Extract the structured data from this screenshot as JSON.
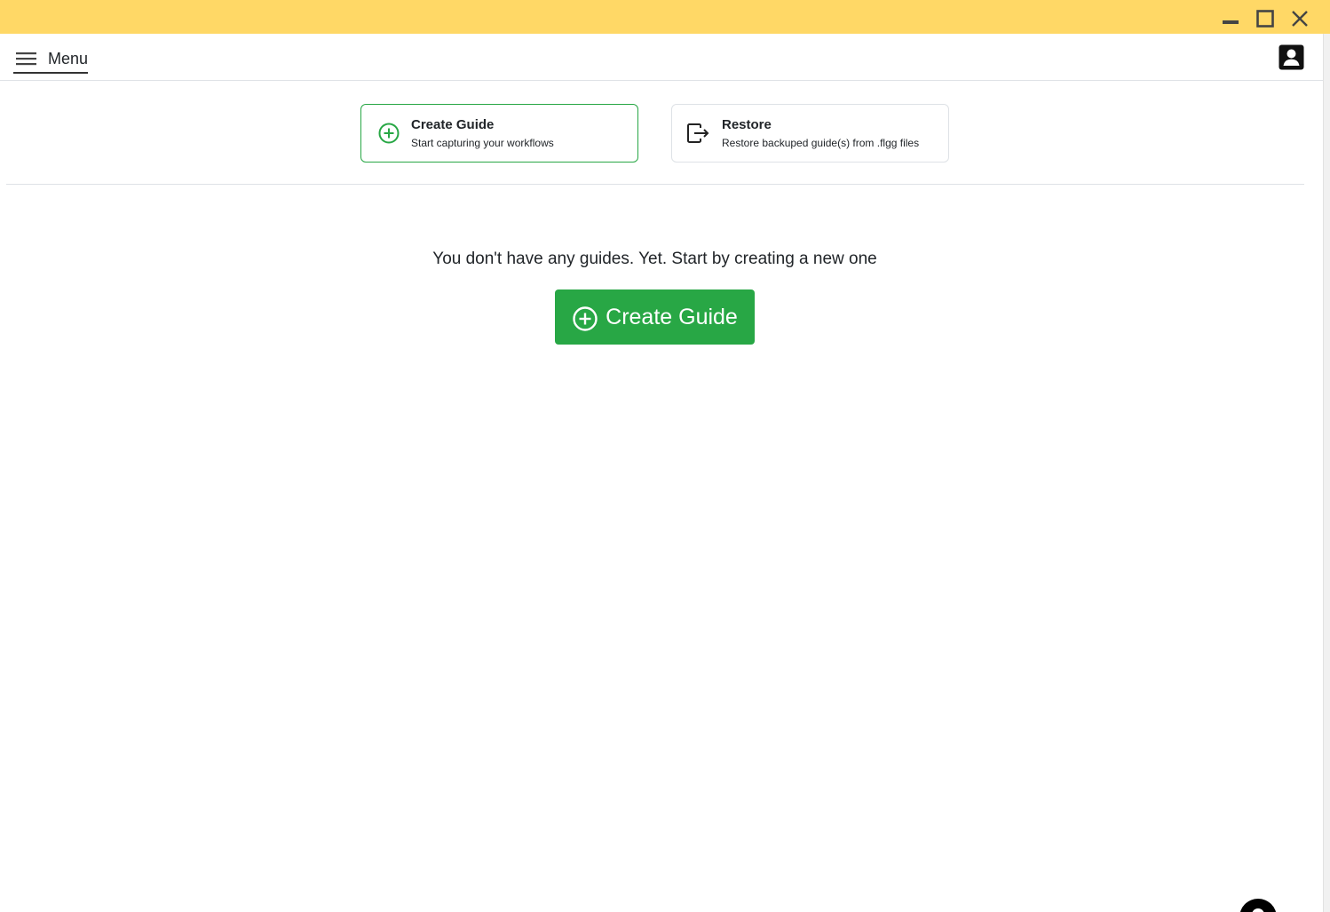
{
  "window": {
    "titlebar_color": "#ffd866",
    "controls": {
      "minimize_icon": "minimize-icon",
      "maximize_icon": "maximize-icon",
      "close_icon": "close-icon"
    }
  },
  "navbar": {
    "menu_label": "Menu",
    "menu_icon": "hamburger-icon",
    "account_icon": "account-box-icon"
  },
  "actions": {
    "create": {
      "title": "Create Guide",
      "subtitle": "Start capturing your workflows",
      "icon": "plus-circle-icon",
      "accent": "#28a745"
    },
    "restore": {
      "title": "Restore",
      "subtitle": "Restore backuped guide(s) from .flgg files",
      "icon": "box-arrow-right-icon"
    }
  },
  "empty_state": {
    "message": "You don't have any guides. Yet. Start by creating a new one",
    "button_label": "Create Guide",
    "button_color": "#28a745"
  },
  "help": {
    "icon": "help-chat-icon"
  }
}
